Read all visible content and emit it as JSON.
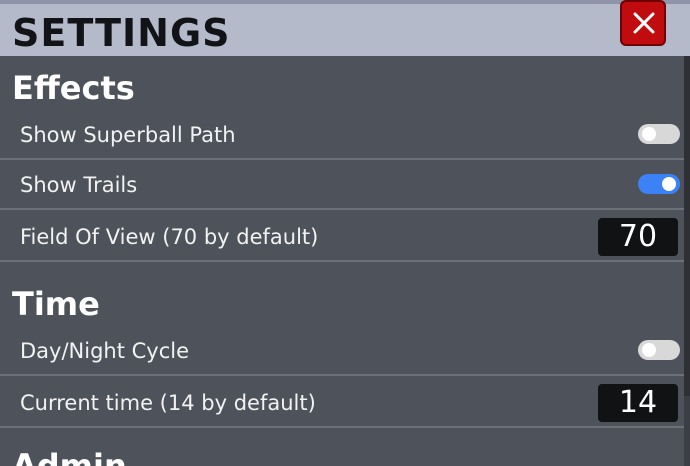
{
  "header": {
    "title": "SETTINGS",
    "close_icon": "close-icon"
  },
  "sections": {
    "effects": {
      "title": "Effects",
      "rows": [
        {
          "label": "Show Superball Path",
          "control": "toggle",
          "value": "off"
        },
        {
          "label": "Show Trails",
          "control": "toggle",
          "value": "on"
        },
        {
          "label": "Field Of View (70 by default)",
          "control": "number",
          "value": "70"
        }
      ]
    },
    "time": {
      "title": "Time",
      "rows": [
        {
          "label": "Day/Night Cycle",
          "control": "toggle",
          "value": "off"
        },
        {
          "label": "Current time (14 by default)",
          "control": "number",
          "value": "14"
        }
      ]
    },
    "admin": {
      "title": "Admin"
    }
  },
  "colors": {
    "panel_bg": "#4e525a",
    "header_bg": "#b5bacb",
    "close_red": "#c00b0f",
    "toggle_on": "#3b82f6",
    "toggle_off": "#d8d8d8",
    "number_box": "#111214"
  }
}
